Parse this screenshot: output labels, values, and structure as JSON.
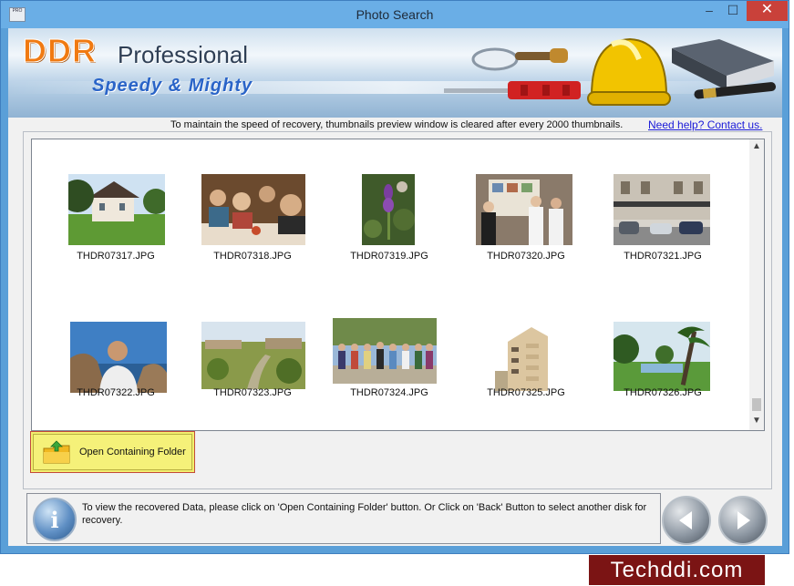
{
  "window": {
    "title": "Photo Search",
    "icon_text": "PRO",
    "minimize_glyph": "–",
    "maximize_glyph": "☐",
    "close_glyph": "✕"
  },
  "banner": {
    "brand": "DDR",
    "product": "Professional",
    "tagline": "Speedy & Mighty"
  },
  "info_bar": {
    "message": "To maintain the speed of recovery, thumbnails preview window is cleared after every 2000 thumbnails.",
    "help_link": "Need help? Contact us."
  },
  "thumbnails": [
    {
      "filename": "THDR07317.JPG",
      "scene": "house-lawn"
    },
    {
      "filename": "THDR07318.JPG",
      "scene": "dinner-party"
    },
    {
      "filename": "THDR07319.JPG",
      "scene": "purple-flower"
    },
    {
      "filename": "THDR07320.JPG",
      "scene": "group-board"
    },
    {
      "filename": "THDR07321.JPG",
      "scene": "street-building"
    },
    {
      "filename": "THDR07322.JPG",
      "scene": "man-sea"
    },
    {
      "filename": "THDR07323.JPG",
      "scene": "river-valley"
    },
    {
      "filename": "THDR07324.JPG",
      "scene": "group-outdoor"
    },
    {
      "filename": "THDR07325.JPG",
      "scene": "apartment-tower"
    },
    {
      "filename": "THDR07326.JPG",
      "scene": "palm-lake"
    }
  ],
  "actions": {
    "open_folder_label": "Open Containing Folder"
  },
  "status": {
    "text": "To view the recovered Data, please click on 'Open Containing Folder' button. Or Click on 'Back' Button to select another disk for recovery."
  },
  "colors": {
    "accent_orange": "#f07a12",
    "tagline_blue": "#2a64c8",
    "highlight_yellow": "#f2ee6e",
    "close_red": "#c9413a"
  },
  "watermark": "Techddi.com"
}
